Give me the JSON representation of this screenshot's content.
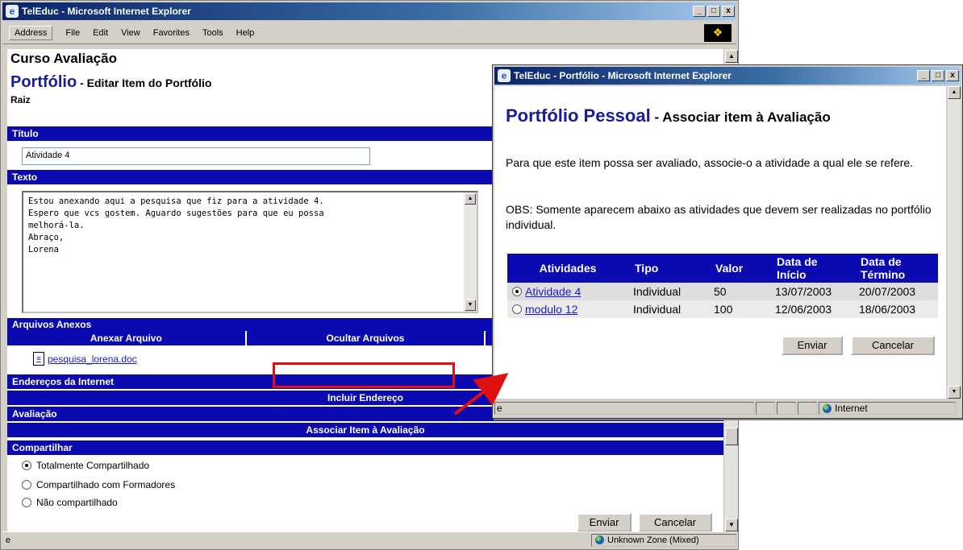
{
  "main_window": {
    "title": "TelEduc - Microsoft Internet Explorer",
    "controls": {
      "minimize": "_",
      "maximize": "□",
      "close": "x"
    },
    "menubar": {
      "address_label": "Address",
      "items": [
        "File",
        "Edit",
        "View",
        "Favorites",
        "Tools",
        "Help"
      ]
    },
    "course_title": "Curso Avaliação",
    "page_title_app": "Portfólio",
    "page_title_rest": " - Editar Item do Portfólio",
    "root_label": "Raiz",
    "titulo_header": "Título",
    "titulo_value": "Atividade 4",
    "texto_header": "Texto",
    "texto_value": "Estou anexando aqui a pesquisa que fiz para a atividade 4.\nEspero que vcs gostem. Aguardo sugestões para que eu possa\nmelhorá-la.\nAbraço,\nLorena",
    "anexos_header": "Arquivos Anexos",
    "anexos_actions": [
      "Anexar Arquivo",
      "Ocultar Arquivos",
      ""
    ],
    "anexo_file": "pesquisa_lorena.doc",
    "enderecos_header": "Endereços da Internet",
    "incluir_endereco": "Incluir Endereço",
    "avaliacao_header": "Avaliação",
    "associar_label": "Associar Item à Avaliação",
    "compartilhar_header": "Compartilhar",
    "share_options": [
      {
        "label": "Totalmente Compartilhado",
        "checked": true
      },
      {
        "label": "Compartilhado com Formadores",
        "checked": false
      },
      {
        "label": "Não compartilhado",
        "checked": false
      }
    ],
    "enviar": "Enviar",
    "cancelar": "Cancelar",
    "status_zone": "Unknown Zone (Mixed)"
  },
  "popup_window": {
    "title": "TelEduc - Portfólio - Microsoft Internet Explorer",
    "heading_app": "Portfólio Pessoal",
    "heading_rest": " - Associar item à Avaliação",
    "para1": "Para que este item possa ser avaliado, associe-o a atividade a qual ele se refere.",
    "para2": "OBS: Somente aparecem abaixo as atividades que devem ser realizadas no portfólio individual.",
    "table": {
      "headers": [
        "Atividades",
        "Tipo",
        "Valor",
        "Data de Início",
        "Data de Término"
      ],
      "rows": [
        {
          "atividade": "Atividade 4",
          "tipo": "Individual",
          "valor": "50",
          "inicio": "13/07/2003",
          "termino": "20/07/2003",
          "selected": true
        },
        {
          "atividade": "modulo 12",
          "tipo": "Individual",
          "valor": "100",
          "inicio": "12/06/2003",
          "termino": "18/06/2003",
          "selected": false
        }
      ]
    },
    "enviar": "Enviar",
    "cancelar": "Cancelar",
    "status_zone": "Internet"
  },
  "colors": {
    "header_bar": "#0a0ab0",
    "title_gradient_start": "#0a246a",
    "highlight": "#e01010",
    "link": "#1a1acc"
  }
}
